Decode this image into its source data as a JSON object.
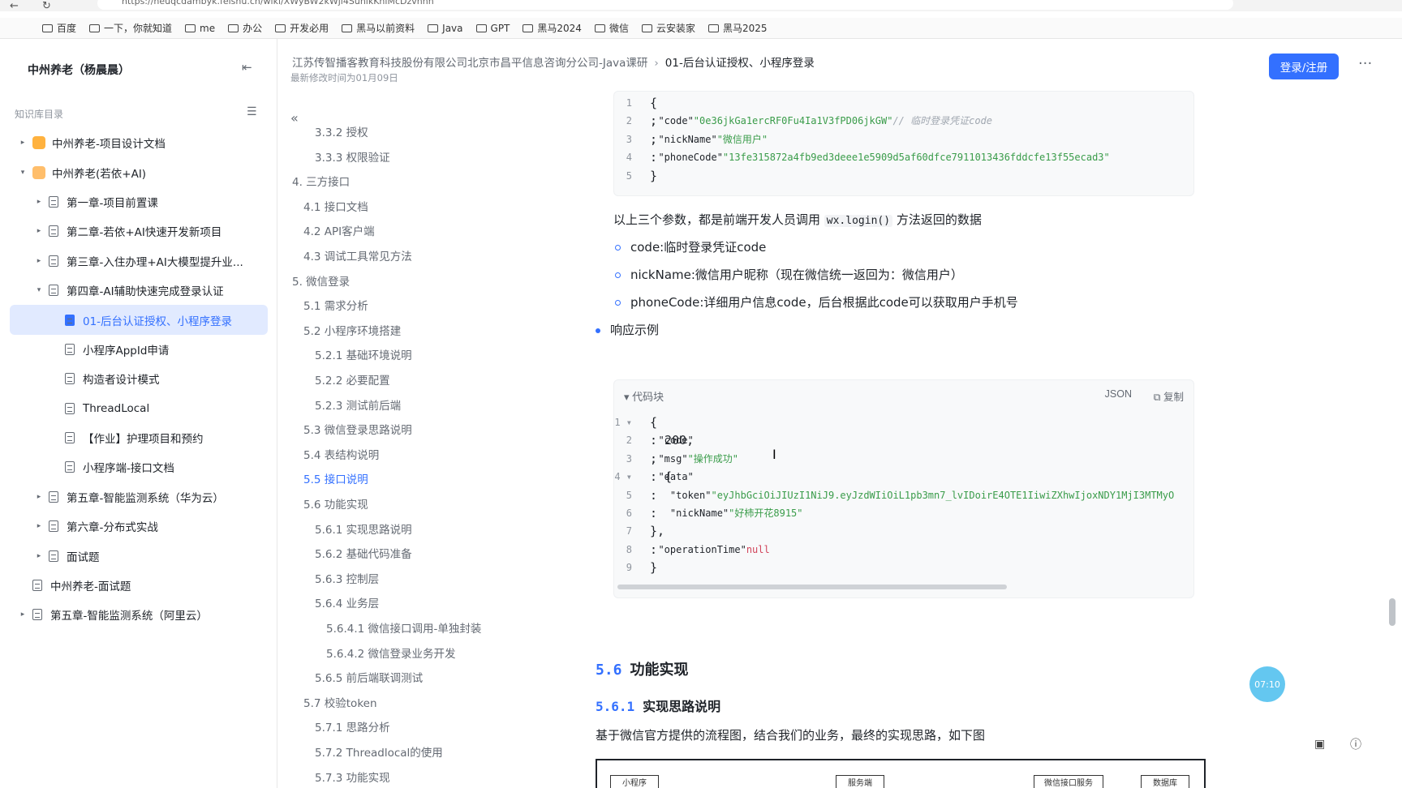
{
  "browser": {
    "url": "https://heuqcdambyk.feishu.cn/wiki/XWyBW2kWjl4SuhikKhiMcDzvnhh",
    "bookmarks": [
      "百度",
      "一下，你就知道",
      "me",
      "办公",
      "开发必用",
      "黑马以前资料",
      "Java",
      "GPT",
      "黑马2024",
      "微信",
      "云安装家",
      "黑马2025"
    ]
  },
  "sidebar": {
    "space_title": "中州养老（杨晨晨）",
    "kb_label": "知识库目录",
    "items": [
      {
        "label": "中州养老-项目设计文档",
        "level": 0,
        "arrow": "▸",
        "icon": "space"
      },
      {
        "label": "中州养老(若依+AI)",
        "level": 0,
        "arrow": "▾",
        "icon": "space"
      },
      {
        "label": "第一章-项目前置课",
        "level": 1,
        "arrow": "▸",
        "icon": "doc"
      },
      {
        "label": "第二章-若依+AI快速开发新项目",
        "level": 1,
        "arrow": "▸",
        "icon": "doc"
      },
      {
        "label": "第三章-入住办理+AI大模型提升业...",
        "level": 1,
        "arrow": "▸",
        "icon": "doc"
      },
      {
        "label": "第四章-AI辅助快速完成登录认证",
        "level": 1,
        "arrow": "▾",
        "icon": "doc"
      },
      {
        "label": "01-后台认证授权、小程序登录",
        "level": 2,
        "arrow": "",
        "icon": "doc",
        "active": true
      },
      {
        "label": "小程序AppId申请",
        "level": 2,
        "arrow": "",
        "icon": "doc"
      },
      {
        "label": "构造者设计模式",
        "level": 2,
        "arrow": "",
        "icon": "doc"
      },
      {
        "label": "ThreadLocal",
        "level": 2,
        "arrow": "",
        "icon": "doc"
      },
      {
        "label": "【作业】护理项目和预约",
        "level": 2,
        "arrow": "",
        "icon": "doc"
      },
      {
        "label": "小程序端-接口文档",
        "level": 2,
        "arrow": "",
        "icon": "doc"
      },
      {
        "label": "第五章-智能监测系统（华为云）",
        "level": 1,
        "arrow": "▸",
        "icon": "doc"
      },
      {
        "label": "第六章-分布式实战",
        "level": 1,
        "arrow": "▸",
        "icon": "doc"
      },
      {
        "label": "面试题",
        "level": 1,
        "arrow": "▸",
        "icon": "doc"
      },
      {
        "label": "中州养老-面试题",
        "level": 0,
        "arrow": "",
        "icon": "doc"
      },
      {
        "label": "第五章-智能监测系统（阿里云）",
        "level": 0,
        "arrow": "▸",
        "icon": "doc"
      }
    ]
  },
  "header": {
    "breadcrumb_parent": "江苏传智播客教育科技股份有限公司北京市昌平信息咨询分公司-Java课研",
    "breadcrumb_current": "01-后台认证授权、小程序登录",
    "edited": "最新修改时间为01月09日",
    "login_label": "登录/注册",
    "more_label": "···"
  },
  "outline": {
    "items": [
      {
        "label": "3.3.2 授权",
        "indent": 2
      },
      {
        "label": "3.3.3 权限验证",
        "indent": 2
      },
      {
        "label": "4. 三方接口",
        "indent": 0
      },
      {
        "label": "4.1 接口文档",
        "indent": 1
      },
      {
        "label": "4.2 API客户端",
        "indent": 1
      },
      {
        "label": "4.3 调试工具常见方法",
        "indent": 1
      },
      {
        "label": "5. 微信登录",
        "indent": 0
      },
      {
        "label": "5.1 需求分析",
        "indent": 1
      },
      {
        "label": "5.2 小程序环境搭建",
        "indent": 1
      },
      {
        "label": "5.2.1 基础环境说明",
        "indent": 2
      },
      {
        "label": "5.2.2 必要配置",
        "indent": 2
      },
      {
        "label": "5.2.3 测试前后端",
        "indent": 2
      },
      {
        "label": "5.3 微信登录思路说明",
        "indent": 1
      },
      {
        "label": "5.4 表结构说明",
        "indent": 1
      },
      {
        "label": "5.5 接口说明",
        "indent": 1,
        "current": true
      },
      {
        "label": "5.6 功能实现",
        "indent": 1
      },
      {
        "label": "5.6.1 实现思路说明",
        "indent": 2
      },
      {
        "label": "5.6.2 基础代码准备",
        "indent": 2
      },
      {
        "label": "5.6.3 控制层",
        "indent": 2
      },
      {
        "label": "5.6.4 业务层",
        "indent": 2
      },
      {
        "label": "5.6.4.1 微信接口调用-单独封装",
        "indent": 3
      },
      {
        "label": "5.6.4.2 微信登录业务开发",
        "indent": 3
      },
      {
        "label": "5.6.5 前后端联调测试",
        "indent": 2
      },
      {
        "label": "5.7 校验token",
        "indent": 1
      },
      {
        "label": "5.7.1 思路分析",
        "indent": 2
      },
      {
        "label": "5.7.2 Threadlocal的使用",
        "indent": 2
      },
      {
        "label": "5.7.3 功能实现",
        "indent": 2
      }
    ]
  },
  "doc": {
    "request_code": {
      "lines": [
        {
          "n": "1",
          "parts": [
            [
              "p",
              "{"
            ]
          ]
        },
        {
          "n": "2",
          "parts": [
            [
              "key",
              "  \"code\""
            ],
            [
              "p",
              ": "
            ],
            [
              "str",
              "\"0e36jkGa1ercRF0Fu4Ia1V3fPD06jkGW\""
            ],
            [
              "p",
              ", "
            ],
            [
              "cmt",
              "// 临时登录凭证code"
            ]
          ]
        },
        {
          "n": "3",
          "parts": [
            [
              "key",
              "  \"nickName\""
            ],
            [
              "p",
              ": "
            ],
            [
              "str",
              "\"微信用户\""
            ],
            [
              "p",
              ","
            ]
          ]
        },
        {
          "n": "4",
          "parts": [
            [
              "key",
              "  \"phoneCode\""
            ],
            [
              "p",
              ": "
            ],
            [
              "str",
              "\"13fe315872a4fb9ed3deee1e5909d5af60dfce7911013436fddcfe13f55ecad3\""
            ]
          ]
        },
        {
          "n": "5",
          "parts": [
            [
              "p",
              "}"
            ]
          ]
        }
      ]
    },
    "para1_prefix": "以上三个参数，都是前端开发人员调用 ",
    "para1_code": "wx.login()",
    "para1_suffix": " 方法返回的数据",
    "bullets": [
      "code:临时登录凭证code",
      "nickName:微信用户昵称（现在微信统一返回为：微信用户）",
      "phoneCode:详细用户信息code，后台根据此code可以获取用户手机号"
    ],
    "response_label": "响应示例",
    "codeblock_title": "代码块",
    "codeblock_lang": "JSON",
    "codeblock_copy": "复制",
    "response_code": {
      "lines": [
        {
          "n": "1 ▾",
          "parts": [
            [
              "p",
              "{"
            ]
          ]
        },
        {
          "n": "2",
          "parts": [
            [
              "key",
              "  \"code\""
            ],
            [
              "p",
              ": 200,"
            ]
          ]
        },
        {
          "n": "3",
          "parts": [
            [
              "key",
              "  \"msg\""
            ],
            [
              "p",
              ": "
            ],
            [
              "str",
              "\"操作成功\""
            ],
            [
              "p",
              ","
            ]
          ]
        },
        {
          "n": "4 ▾",
          "parts": [
            [
              "key",
              "  \"data\""
            ],
            [
              "p",
              ": {"
            ]
          ]
        },
        {
          "n": "5",
          "parts": [
            [
              "key",
              "    \"token\""
            ],
            [
              "p",
              ": "
            ],
            [
              "str",
              "\"eyJhbGciOiJIUzI1NiJ9.eyJzdWIiOiL1pb3mn7_lvIDoirE4OTE1IiwiZXhwIjoxNDY1MjI3MTMyO"
            ]
          ]
        },
        {
          "n": "6",
          "parts": [
            [
              "key",
              "    \"nickName\""
            ],
            [
              "p",
              ": "
            ],
            [
              "str",
              "\"好柿开花8915\""
            ]
          ]
        },
        {
          "n": "7",
          "parts": [
            [
              "p",
              "  },"
            ]
          ]
        },
        {
          "n": "8",
          "parts": [
            [
              "key",
              "  \"operationTime\""
            ],
            [
              "p",
              ": "
            ],
            [
              "kw",
              "null"
            ]
          ]
        },
        {
          "n": "9",
          "parts": [
            [
              "p",
              "}"
            ]
          ]
        }
      ]
    },
    "h_56_num": "5.6",
    "h_56_text": "功能实现",
    "h_561_num": "5.6.1",
    "h_561_text": "实现思路说明",
    "para2": "基于微信官方提供的流程图，结合我们的业务，最终的实现思路，如下图",
    "diagram_boxes": [
      "小程序",
      "服务端",
      "微信接口服务",
      "数据库"
    ]
  },
  "widgets": {
    "timer": "07:10"
  },
  "colors": {
    "accent": "#3370ff",
    "active_bg": "#e1eaff",
    "string": "#3a9c4a"
  }
}
